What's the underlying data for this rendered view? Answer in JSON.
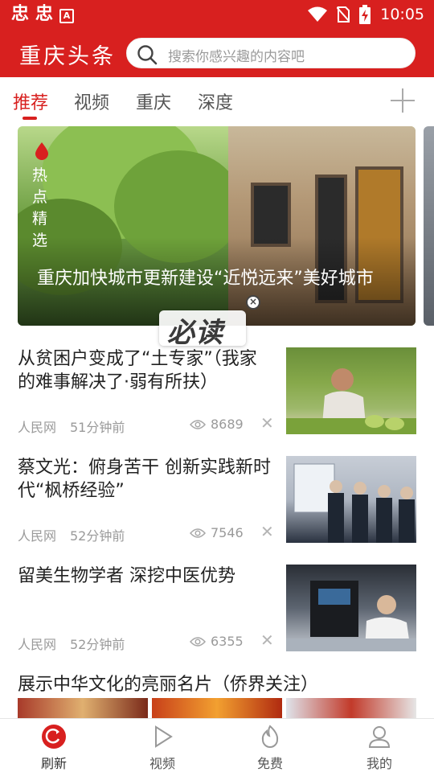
{
  "status_bar": {
    "app_icons": [
      "忠",
      "忠"
    ],
    "a_icon": "A",
    "time": "10:05"
  },
  "header": {
    "brand": "重庆头条",
    "search_placeholder": "搜索你感兴趣的内容吧"
  },
  "tabs": [
    {
      "label": "推荐",
      "active": true
    },
    {
      "label": "视频",
      "active": false
    },
    {
      "label": "重庆",
      "active": false
    },
    {
      "label": "深度",
      "active": false
    }
  ],
  "banner": {
    "tag": "热点精选",
    "title": "重庆加快城市更新建设“近悦远来”美好城市"
  },
  "floating_badge": {
    "label": "必读",
    "close_icon": "close-icon"
  },
  "news": [
    {
      "headline": "从贫困户变成了“土专家”（我家的难事解决了·弱有所扶）",
      "source": "人民网",
      "time": "51分钟前",
      "views": "8689"
    },
    {
      "headline": "蔡文光：俯身苦干 创新实践新时代“枫桥经验”",
      "source": "人民网",
      "time": "52分钟前",
      "views": "7546"
    },
    {
      "headline": "留美生物学者 深挖中医优势",
      "source": "人民网",
      "time": "52分钟前",
      "views": "6355"
    }
  ],
  "partial_headline": "展示中华文化的亮丽名片（侨界关注）",
  "bottom_nav": [
    {
      "label": "刷新",
      "icon": "refresh-icon",
      "active": true
    },
    {
      "label": "视频",
      "icon": "play-icon",
      "active": false
    },
    {
      "label": "免费",
      "icon": "flame-icon",
      "active": false
    },
    {
      "label": "我的",
      "icon": "user-icon",
      "active": false
    }
  ],
  "colors": {
    "brand_red": "#d8201f",
    "meta_gray": "#9a9a9a"
  }
}
